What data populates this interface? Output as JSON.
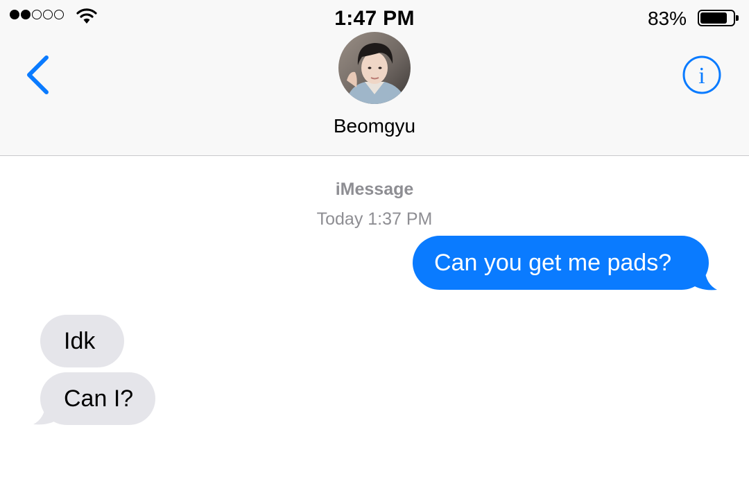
{
  "status_bar": {
    "signal_filled": 2,
    "signal_total": 5,
    "wifi_icon": "wifi-icon",
    "time": "1:47 PM",
    "battery_percent": "83%",
    "battery_level": 0.83
  },
  "header": {
    "back_icon": "chevron-left-icon",
    "contact_name": "Beomgyu",
    "info_icon": "info-circle-icon",
    "info_glyph": "i"
  },
  "conversation": {
    "service": "iMessage",
    "timestamp": "Today 1:37 PM",
    "messages": [
      {
        "direction": "sent",
        "text": "Can you get me pads?"
      },
      {
        "direction": "received",
        "text": "Idk"
      },
      {
        "direction": "received",
        "text": "Can I?"
      }
    ]
  },
  "colors": {
    "accent": "#0a7bff",
    "sent_bubble": "#0a7bff",
    "received_bubble": "#e5e5ea",
    "secondary_text": "#8e8e93",
    "header_bg": "#f8f8f8"
  }
}
